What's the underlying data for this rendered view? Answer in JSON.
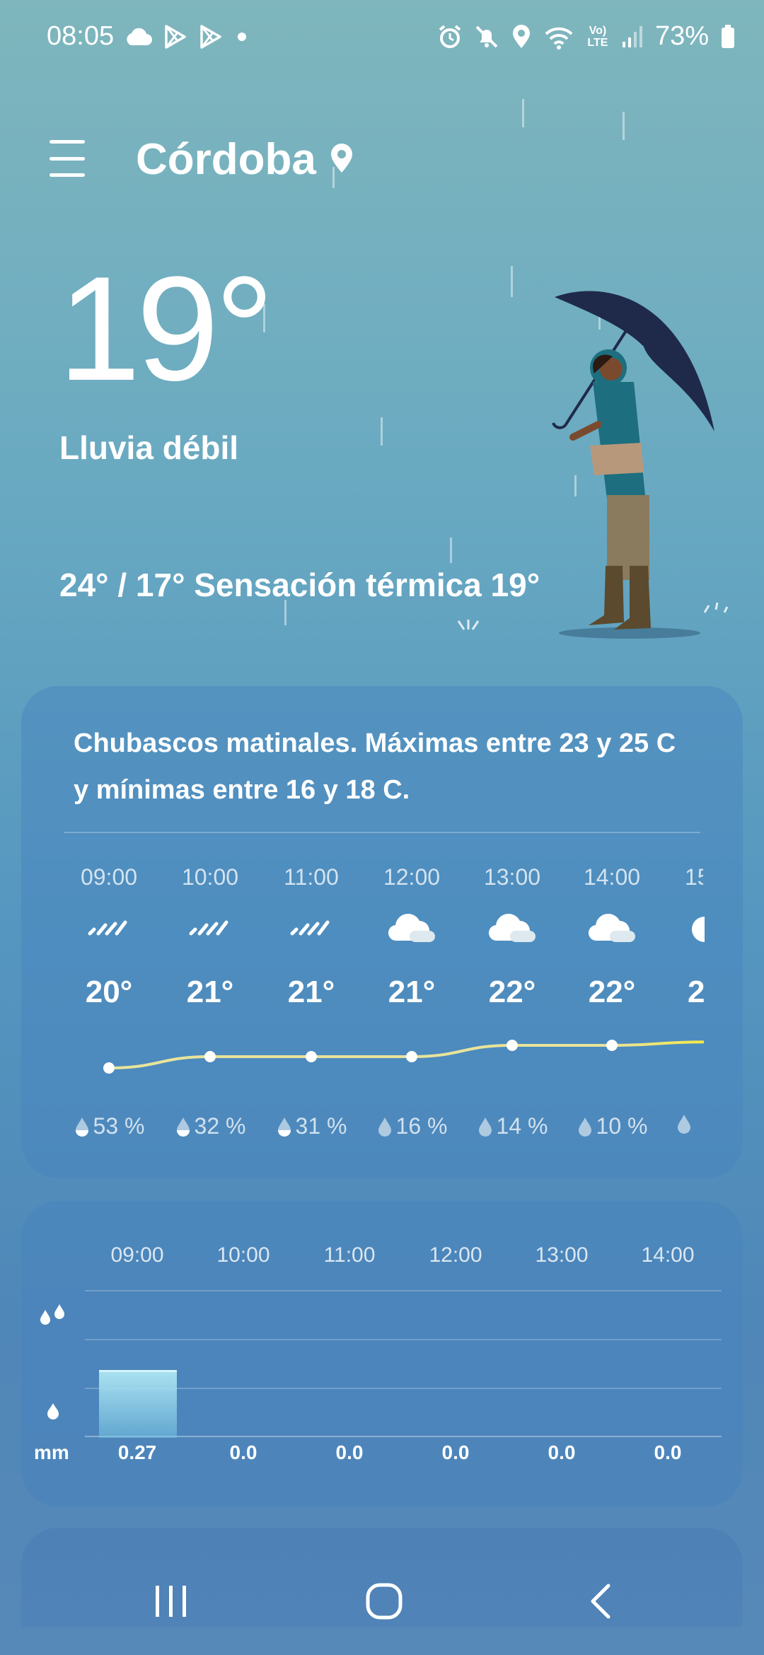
{
  "status_bar": {
    "time": "08:05",
    "icons_left": [
      "cloud-icon",
      "play-store-icon",
      "play-store-icon",
      "dot-icon"
    ],
    "icons_right": [
      "alarm-icon",
      "mute-icon",
      "location-icon",
      "wifi-icon",
      "volte-icon",
      "signal-icon"
    ],
    "volte_label": "Vo) LTE",
    "battery": "73%"
  },
  "header": {
    "city": "Córdoba",
    "menu_icon": "hamburger-menu-icon",
    "location_icon": "location-pin-icon"
  },
  "current": {
    "temperature": "19°",
    "condition": "Lluvia débil",
    "minmax_feels": "24° / 17° Sensación térmica 19°"
  },
  "forecast_card": {
    "summary": "Chubascos matinales. Máximas entre 23 y 25 C y mínimas entre 16 y 18 C.",
    "hours": [
      {
        "time": "09:00",
        "icon": "light-rain-icon",
        "temp": "20°",
        "precip": "53 %"
      },
      {
        "time": "10:00",
        "icon": "light-rain-icon",
        "temp": "21°",
        "precip": "32 %"
      },
      {
        "time": "11:00",
        "icon": "light-rain-icon",
        "temp": "21°",
        "precip": "31 %"
      },
      {
        "time": "12:00",
        "icon": "cloudy-icon",
        "temp": "21°",
        "precip": "16 %"
      },
      {
        "time": "13:00",
        "icon": "cloudy-icon",
        "temp": "22°",
        "precip": "14 %"
      },
      {
        "time": "14:00",
        "icon": "cloudy-icon",
        "temp": "22°",
        "precip": "10 %"
      },
      {
        "time": "15",
        "icon": "cloudy-icon",
        "temp": "2",
        "precip": ""
      }
    ],
    "temp_line_values": [
      20,
      21,
      21,
      21,
      22,
      22,
      22.3
    ]
  },
  "precip_card": {
    "unit": "mm",
    "hours": [
      "09:00",
      "10:00",
      "11:00",
      "12:00",
      "13:00",
      "14:00"
    ],
    "values": [
      "0.27",
      "0.0",
      "0.0",
      "0.0",
      "0.0",
      "0.0"
    ],
    "amounts": [
      0.27,
      0,
      0,
      0,
      0,
      0
    ],
    "scale_icons": [
      "heavy-drops-icon",
      "light-drop-icon"
    ]
  },
  "nav_bar": {
    "items": [
      "recent-apps-icon",
      "home-icon",
      "back-icon"
    ]
  },
  "colors": {
    "temp_line": "#e8e49a",
    "rain_bar": "#a8e0ef",
    "umbrella": "#1f2a4a",
    "coat": "#1d6f80"
  }
}
